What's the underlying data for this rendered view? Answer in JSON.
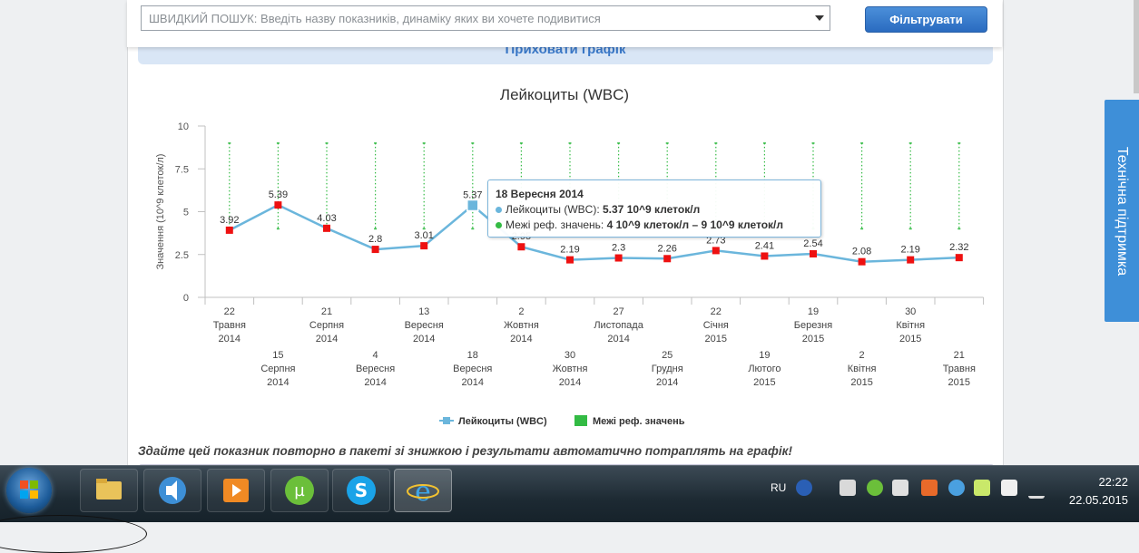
{
  "search": {
    "placeholder": "ШВИДКИЙ ПОШУК: Введіть назву показників, динаміку яких ви хочете подивитися",
    "filter_label": "Фільтрувати"
  },
  "hide_chart_label": "Приховати графік",
  "chart_data": {
    "type": "line",
    "title": "Лейкоциты (WBC)",
    "ylabel": "Значення (10^9 клеток/л)",
    "ylim": [
      0,
      10
    ],
    "yticks": [
      "0",
      "2.5",
      "5",
      "7.5",
      "10"
    ],
    "x": [
      {
        "day": "22",
        "month": "Травня",
        "year": "2014"
      },
      {
        "day": "15",
        "month": "Серпня",
        "year": "2014"
      },
      {
        "day": "21",
        "month": "Серпня",
        "year": "2014"
      },
      {
        "day": "4",
        "month": "Вересня",
        "year": "2014"
      },
      {
        "day": "13",
        "month": "Вересня",
        "year": "2014"
      },
      {
        "day": "18",
        "month": "Вересня",
        "year": "2014"
      },
      {
        "day": "2",
        "month": "Жовтня",
        "year": "2014"
      },
      {
        "day": "30",
        "month": "Жовтня",
        "year": "2014"
      },
      {
        "day": "27",
        "month": "Листопада",
        "year": "2014"
      },
      {
        "day": "25",
        "month": "Грудня",
        "year": "2014"
      },
      {
        "day": "22",
        "month": "Січня",
        "year": "2015"
      },
      {
        "day": "19",
        "month": "Лютого",
        "year": "2015"
      },
      {
        "day": "19",
        "month": "Березня",
        "year": "2015"
      },
      {
        "day": "2",
        "month": "Квітня",
        "year": "2015"
      },
      {
        "day": "30",
        "month": "Квітня",
        "year": "2015"
      },
      {
        "day": "21",
        "month": "Травня",
        "year": "2015"
      }
    ],
    "series": [
      {
        "name": "Лейкоциты (WBC)",
        "color": "#6bb6dc",
        "values": [
          3.92,
          5.39,
          4.03,
          2.8,
          3.01,
          5.37,
          2.95,
          2.19,
          2.3,
          2.26,
          2.73,
          2.41,
          2.54,
          2.08,
          2.19,
          2.32
        ],
        "labels": [
          "3.92",
          "5.39",
          "4.03",
          "2.8",
          "3.01",
          "5.37",
          "2.95",
          "2.19",
          "2.3",
          "2.26",
          "2.73",
          "2.41",
          "2.54",
          "2.08",
          "2.19",
          "2.32"
        ]
      },
      {
        "name": "Межі реф. значень",
        "color": "#33bb44",
        "low": 4,
        "high": 9
      }
    ],
    "highlight_index": 5,
    "legend_position": "bottom"
  },
  "tooltip": {
    "date": "18 Вересня 2014",
    "series_label": "Лейкоциты (WBC): ",
    "series_value": "5.37 10^9 клеток/л",
    "range_label": "Межі реф. значень: ",
    "range_value": "4 10^9 клеток/л – 9 10^9 клеток/л"
  },
  "note": "Здайте цей показник повторно в пакеті зі знижкою і результати автоматично потраплять на графік!",
  "support_label": "Технічна підтримка",
  "taskbar": {
    "apps": [
      "explorer-icon",
      "media-icon",
      "player-icon",
      "utorrent-icon",
      "skype-icon",
      "ie-icon"
    ],
    "lang": "RU",
    "time": "22:22",
    "date": "22.05.2015"
  }
}
